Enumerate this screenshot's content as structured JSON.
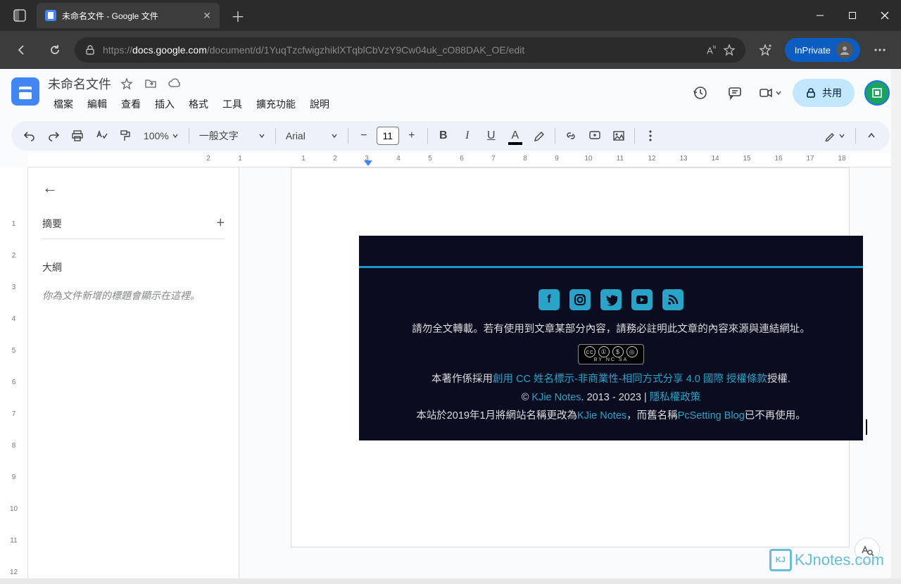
{
  "browser": {
    "tab_title": "未命名文件 - Google 文件",
    "url_prefix": "https://",
    "url_host": "docs.google.com",
    "url_path": "/document/d/1YuqTzcfwigzhiklXTqblCbVzY9Cw04uk_cO88DAK_OE/edit",
    "inprivate_label": "InPrivate"
  },
  "docs": {
    "title": "未命名文件",
    "menu": [
      "檔案",
      "編輯",
      "查看",
      "插入",
      "格式",
      "工具",
      "擴充功能",
      "說明"
    ],
    "share_label": "共用"
  },
  "toolbar": {
    "zoom": "100%",
    "style": "一般文字",
    "font": "Arial",
    "fontsize": "11"
  },
  "outline": {
    "summary_label": "摘要",
    "section_label": "大綱",
    "placeholder": "你為文件新增的標題會顯示在這裡。"
  },
  "pasted": {
    "line1": "請勿全文轉載。若有使用到文章某部分內容，請務必註明此文章的內容來源與連結網址。",
    "cc_small": "BY NC SA",
    "license_pre": "本著作係採用",
    "license_link": "創用 CC 姓名標示-非商業性-相同方式分享 4.0 國際 授權條款",
    "license_post": "授權.",
    "copy_pre": "© ",
    "copy_link": "KJie Notes",
    "copy_mid": ". 2013 - 2023 | ",
    "privacy_link": "隱私權政策",
    "rename_pre": "本站於2019年1月將網站名稱更改為",
    "rename_link1": "KJie Notes",
    "rename_mid": "，而舊名稱",
    "rename_link2": "PcSetting Blog",
    "rename_post": "已不再使用。"
  },
  "watermark": {
    "logo_text": "KJ",
    "text": "KJnotes.com"
  }
}
